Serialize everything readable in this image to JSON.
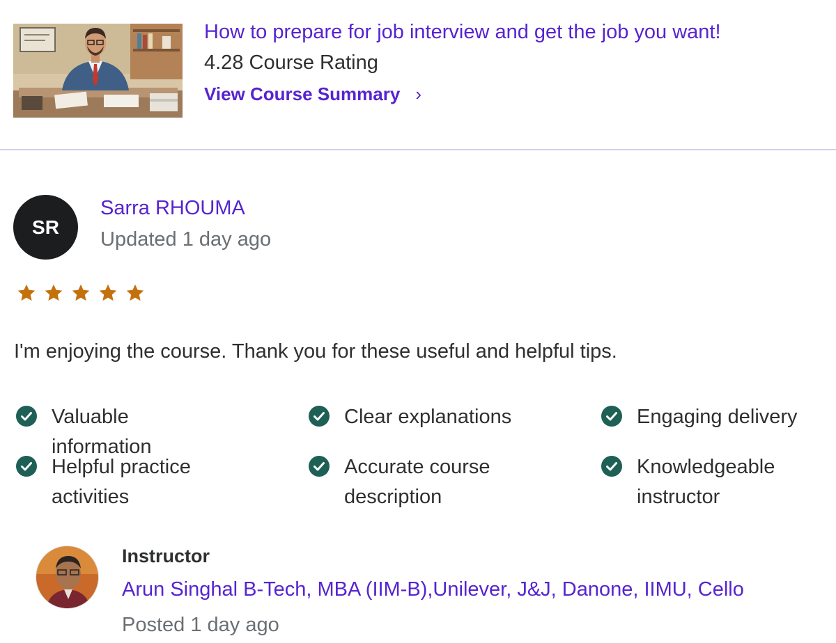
{
  "course": {
    "title": "How to prepare for job interview and get the job you want!",
    "rating_text": "4.28 Course Rating",
    "summary_link": "View Course Summary",
    "summary_icon": "chevron-right-icon"
  },
  "review": {
    "reviewer_initials": "SR",
    "reviewer_name": "Sarra RHOUMA",
    "updated": "Updated 1 day ago",
    "stars": 5,
    "star_color": "#c4710d",
    "text": "I'm enjoying the course. Thank you for these useful and helpful tips.",
    "tags": [
      "Valuable information",
      "Clear explanations",
      "Engaging delivery",
      "Helpful practice activities",
      "Accurate course description",
      "Knowledgeable instructor"
    ],
    "tag_icon": "check-circle-icon",
    "tag_icon_color": "#1e6055"
  },
  "instructor": {
    "heading": "Instructor",
    "name": "Arun Singhal B-Tech, MBA (IIM-B),Unilever, J&J, Danone, IIMU, Cello",
    "posted": "Posted 1 day ago"
  },
  "colors": {
    "accent": "#5624d0",
    "divider": "#d1d0e6",
    "muted_text": "#6a6f73"
  }
}
